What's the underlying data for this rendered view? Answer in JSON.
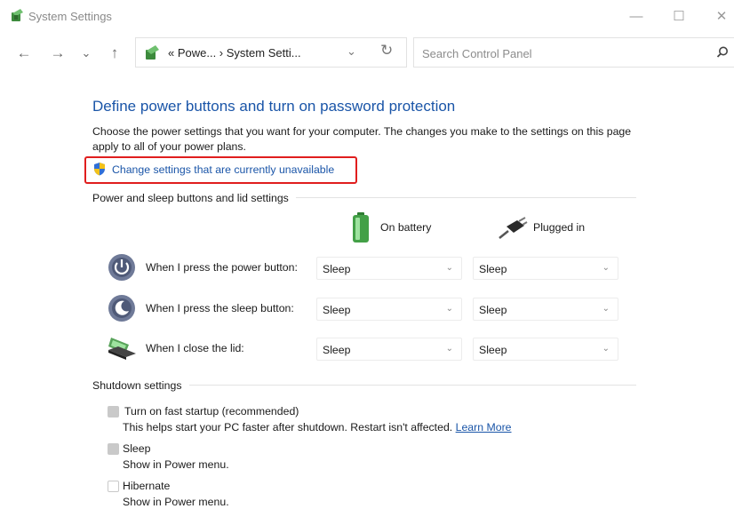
{
  "window": {
    "title": "System Settings",
    "minimize": "—",
    "maximize": "☐",
    "close": "✕"
  },
  "nav": {
    "back": "←",
    "forward": "→",
    "recent": "⌄",
    "up": "↑"
  },
  "address": {
    "text": "« Powe...  ›  System Setti...",
    "chevron": "⌄",
    "refresh": "↻"
  },
  "search": {
    "placeholder": "Search Control Panel"
  },
  "main": {
    "heading": "Define power buttons and turn on password protection",
    "description": "Choose the power settings that you want for your computer. The changes you make to the settings on this page apply to all of your power plans.",
    "change_link": "Change settings that are currently unavailable"
  },
  "power_section": {
    "title": "Power and sleep buttons and lid settings",
    "columns": [
      "On battery",
      "Plugged in"
    ],
    "rows": [
      {
        "label": "When I press the power button:",
        "icon": "power-button-icon",
        "battery": "Sleep",
        "plugged": "Sleep"
      },
      {
        "label": "When I press the sleep button:",
        "icon": "sleep-button-icon",
        "battery": "Sleep",
        "plugged": "Sleep"
      },
      {
        "label": "When I close the lid:",
        "icon": "laptop-lid-icon",
        "battery": "Sleep",
        "plugged": "Sleep"
      }
    ]
  },
  "shutdown_section": {
    "title": "Shutdown settings",
    "items": [
      {
        "label": "Turn on fast startup (recommended)",
        "description": "This helps start your PC faster after shutdown. Restart isn't affected.",
        "link": "Learn More",
        "checked": true
      },
      {
        "label": "Sleep",
        "description": "Show in Power menu.",
        "checked": true
      },
      {
        "label": "Hibernate",
        "description": "Show in Power menu.",
        "checked": false
      }
    ]
  },
  "colors": {
    "link": "#1a55a8",
    "highlight_box": "#e01e1e"
  }
}
